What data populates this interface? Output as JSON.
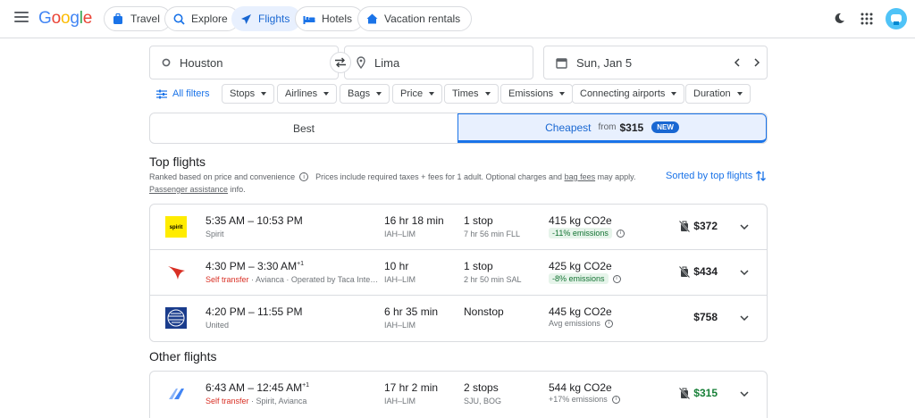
{
  "header": {
    "logo": [
      "G",
      "o",
      "o",
      "g",
      "l",
      "e"
    ],
    "tabs": [
      {
        "label": "Travel",
        "icon": "suitcase-icon",
        "active": false
      },
      {
        "label": "Explore",
        "icon": "explore-icon",
        "active": false
      },
      {
        "label": "Flights",
        "icon": "plane-icon",
        "active": true
      },
      {
        "label": "Hotels",
        "icon": "bed-icon",
        "active": false
      },
      {
        "label": "Vacation rentals",
        "icon": "house-icon",
        "active": false
      }
    ]
  },
  "search": {
    "origin": "Houston",
    "destination": "Lima",
    "date": "Sun, Jan 5"
  },
  "filters": {
    "all_label": "All filters",
    "chips": [
      "Stops",
      "Airlines",
      "Bags",
      "Price",
      "Times",
      "Emissions",
      "Connecting airports",
      "Duration"
    ]
  },
  "sort_toggle": {
    "best": "Best",
    "cheapest": "Cheapest",
    "from": "from",
    "cheapest_price": "$315",
    "badge": "NEW"
  },
  "top_flights": {
    "title": "Top flights",
    "subtitle_1": "Ranked based on price and convenience",
    "subtitle_2": "Prices include required taxes + fees for 1 adult. Optional charges and",
    "bag_fees": "bag fees",
    "subtitle_3": "may apply.",
    "passenger_assistance": "Passenger assistance",
    "info_suffix": "info.",
    "sorted_label": "Sorted by top flights"
  },
  "flights": [
    {
      "times": "5:35 AM – 10:53 PM",
      "plus": "",
      "self_transfer": "",
      "airline": "Spirit",
      "duration": "16 hr 18 min",
      "route": "IAH–LIM",
      "stops": "1 stop",
      "stop_info": "7 hr 56 min FLL",
      "co2": "415 kg CO2e",
      "emissions": "-11% emissions",
      "emis_tag": true,
      "price": "$372",
      "price_green": false,
      "no_bag": true,
      "logo": "spirit"
    },
    {
      "times": "4:30 PM – 3:30 AM",
      "plus": "+1",
      "self_transfer": "Self transfer",
      "airline": " · Avianca · Operated by Taca International Airlines",
      "duration": "10 hr",
      "route": "IAH–LIM",
      "stops": "1 stop",
      "stop_info": "2 hr 50 min SAL",
      "co2": "425 kg CO2e",
      "emissions": "-8% emissions",
      "emis_tag": true,
      "price": "$434",
      "price_green": false,
      "no_bag": true,
      "logo": "avianca"
    },
    {
      "times": "4:20 PM – 11:55 PM",
      "plus": "",
      "self_transfer": "",
      "airline": "United",
      "duration": "6 hr 35 min",
      "route": "IAH–LIM",
      "stops": "Nonstop",
      "stop_info": "",
      "co2": "445 kg CO2e",
      "emissions": "Avg emissions",
      "emis_tag": false,
      "price": "$758",
      "price_green": false,
      "no_bag": false,
      "logo": "united"
    }
  ],
  "other_flights": {
    "title": "Other flights",
    "items": [
      {
        "times": "6:43 AM – 12:45 AM",
        "plus": "+1",
        "self_transfer": "Self transfer",
        "airline": " · Spirit, Avianca",
        "duration": "17 hr 2 min",
        "route": "IAH–LIM",
        "stops": "2 stops",
        "stop_info": "SJU, BOG",
        "co2": "544 kg CO2e",
        "emissions": "+17% emissions",
        "emis_tag": false,
        "price": "$315",
        "price_green": true,
        "no_bag": true,
        "logo": "multi"
      }
    ]
  },
  "colors": {
    "accent": "#1a73e8",
    "active_bg": "#e8f0fe",
    "red": "#d93025",
    "green": "#188038"
  }
}
